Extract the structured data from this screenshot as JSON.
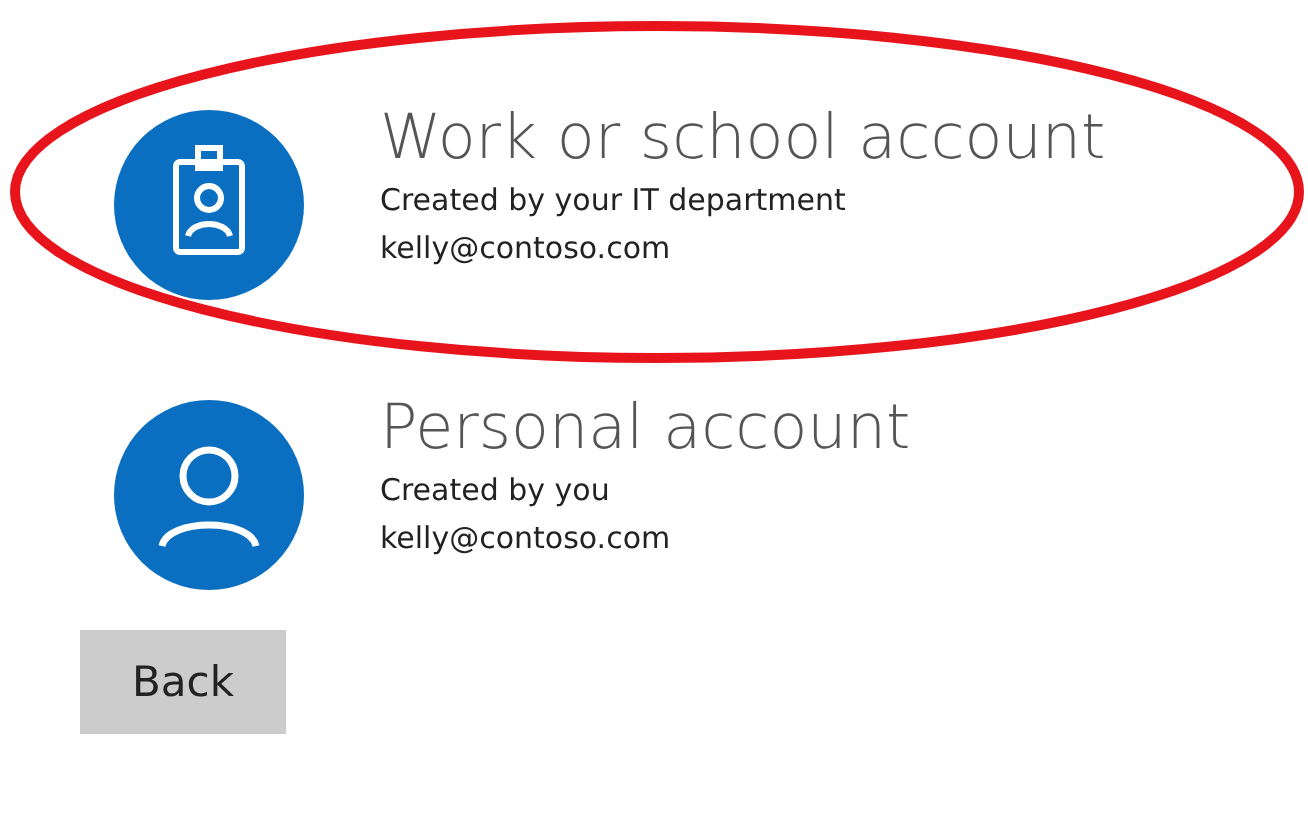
{
  "accounts": [
    {
      "kind": "work",
      "title": "Work or school account",
      "subtitle": "Created by your IT department",
      "email": "kelly@contoso.com",
      "highlighted": true
    },
    {
      "kind": "personal",
      "title": "Personal account",
      "subtitle": "Created by you",
      "email": "kelly@contoso.com",
      "highlighted": false
    }
  ],
  "buttons": [
    "Back"
  ]
}
